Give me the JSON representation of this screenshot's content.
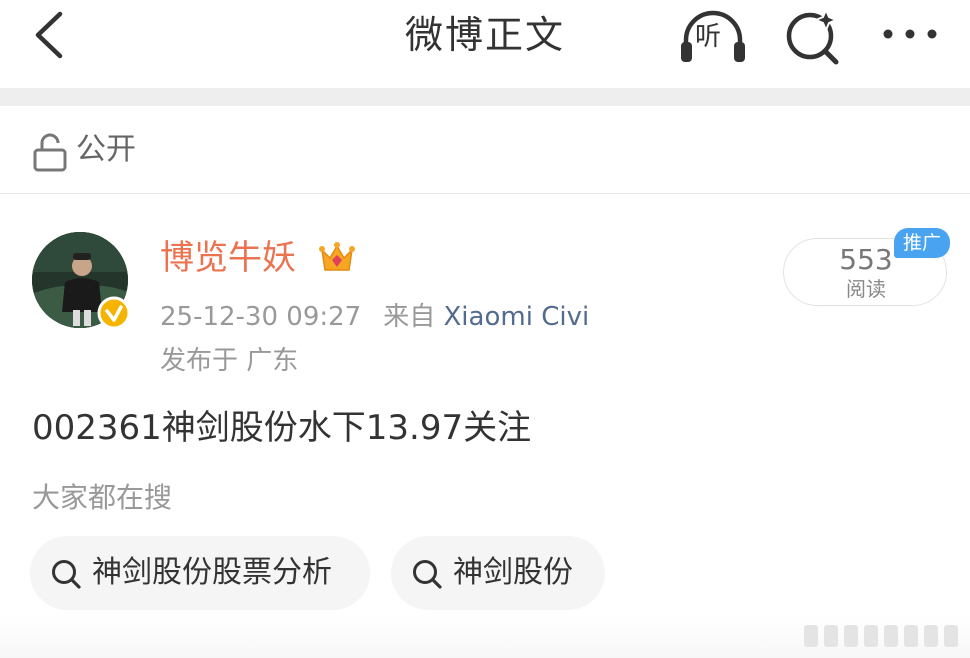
{
  "header": {
    "title": "微博正文",
    "listen_label": "听",
    "icons": {
      "back": "chevron-left-icon",
      "listen": "headphones-icon",
      "search": "sparkle-search-icon",
      "more": "more-dots-icon"
    }
  },
  "visibility": {
    "label": "公开",
    "icon": "unlock-icon"
  },
  "author": {
    "name": "博览牛妖",
    "name_color": "#eb7350",
    "badge": "crown-icon",
    "verified": "verified-badge-icon",
    "timestamp": "25-12-30 09:27",
    "source_prefix": "来自",
    "source": "Xiaomi Civi",
    "location": "发布于 广东"
  },
  "read_stats": {
    "count": "553",
    "label": "阅读",
    "badge": "推广"
  },
  "post": {
    "text": "002361神剑股份水下13.97关注"
  },
  "trending": {
    "heading": "大家都在搜",
    "chips": [
      {
        "label": "神剑股份股票分析",
        "icon": "search-icon"
      },
      {
        "label": "神剑股份",
        "icon": "search-icon"
      }
    ]
  },
  "colors": {
    "accent": "#eb7350",
    "link": "#536b8e",
    "promote": "#4aa3f0",
    "verified": "#f5b400"
  }
}
